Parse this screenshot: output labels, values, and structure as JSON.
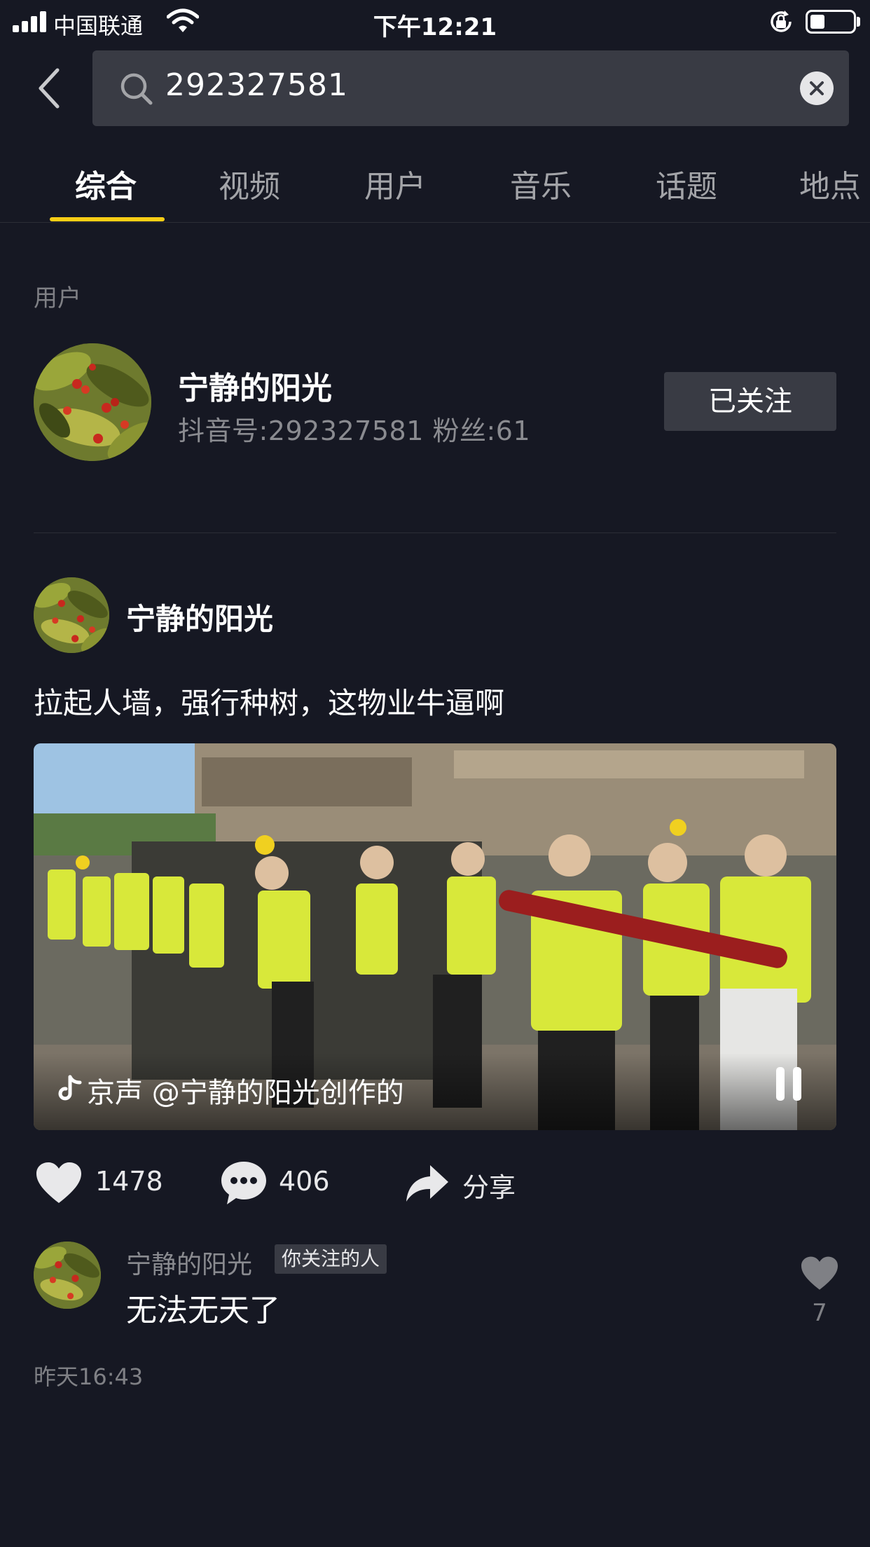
{
  "status_bar": {
    "carrier": "中国联通",
    "time": "下午12:21",
    "battery_level": 0.35
  },
  "search": {
    "query": "292327581"
  },
  "tabs": [
    {
      "label": "综合",
      "active": true
    },
    {
      "label": "视频",
      "active": false
    },
    {
      "label": "用户",
      "active": false
    },
    {
      "label": "音乐",
      "active": false
    },
    {
      "label": "话题",
      "active": false
    },
    {
      "label": "地点",
      "active": false
    }
  ],
  "user_section": {
    "label": "用户",
    "name": "宁静的阳光",
    "meta": "抖音号:292327581  粉丝:61",
    "follow_label": "已关注"
  },
  "post": {
    "author": "宁静的阳光",
    "caption": "拉起人墙，强行种树，这物业牛逼啊",
    "music_text": "京声   @宁静的阳光创作的",
    "likes": "1478",
    "comments": "406",
    "share_label": "分享"
  },
  "comment": {
    "author": "宁静的阳光",
    "badge": "你关注的人",
    "text": "无法无天了",
    "likes": "7"
  },
  "timestamp": "昨天16:43",
  "colors": {
    "background": "#161823",
    "accent": "#face15",
    "surface": "#393b44"
  }
}
